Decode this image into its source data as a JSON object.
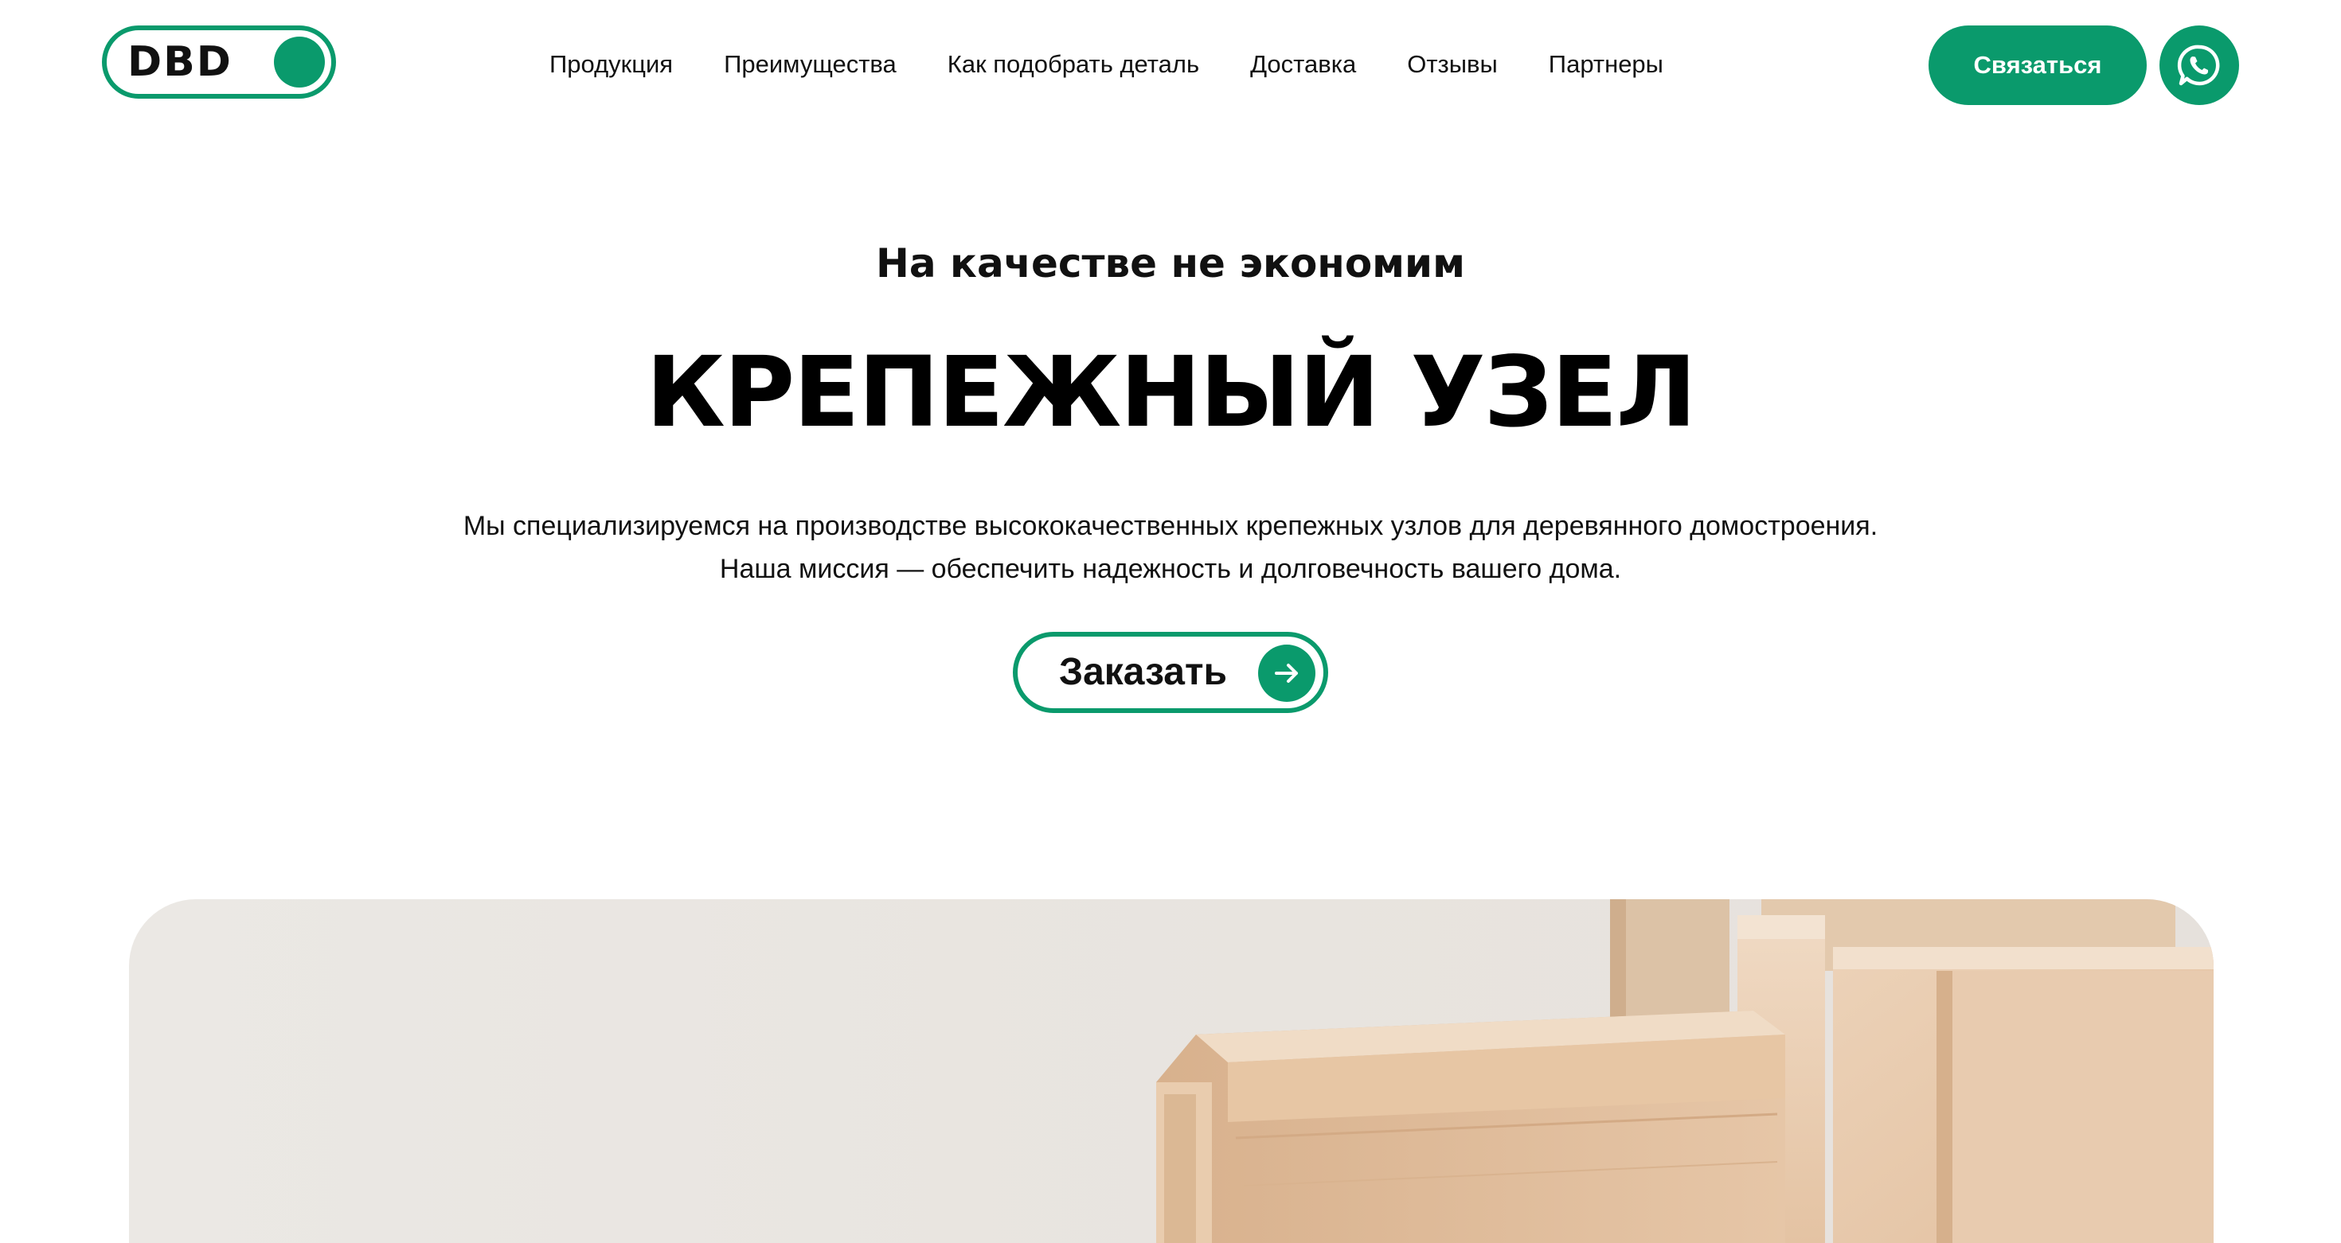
{
  "header": {
    "logo_text": "DBD",
    "nav": [
      {
        "label": "Продукция"
      },
      {
        "label": "Преимущества"
      },
      {
        "label": "Как подобрать деталь"
      },
      {
        "label": "Доставка"
      },
      {
        "label": "Отзывы"
      },
      {
        "label": "Партнеры"
      }
    ],
    "contact_label": "Связаться",
    "whatsapp_icon": "whatsapp-icon"
  },
  "hero": {
    "eyebrow": "На качестве не экономим",
    "title": "КРЕПЕЖНЫЙ УЗЕЛ",
    "description_line1": "Мы специализируемся на производстве высококачественных крепежных узлов для деревянного домостроения.",
    "description_line2": "Наша миссия — обеспечить надежность и долговечность вашего дома.",
    "order_label": "Заказать",
    "order_icon": "arrow-right-icon"
  },
  "colors": {
    "accent": "#0a9a6c",
    "text": "#111111",
    "background": "#ffffff"
  }
}
